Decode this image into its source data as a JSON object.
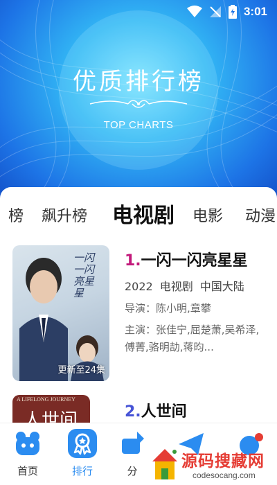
{
  "status_bar": {
    "time": "3:01"
  },
  "hero": {
    "title": "优质排行榜",
    "subtitle": "TOP CHARTS"
  },
  "tabs": [
    {
      "label": "榜",
      "active": false
    },
    {
      "label": "飙升榜",
      "active": false
    },
    {
      "label": "电视剧",
      "active": true
    },
    {
      "label": "电影",
      "active": false
    },
    {
      "label": "动漫",
      "active": false
    }
  ],
  "items": [
    {
      "rank": "1.",
      "title": "一闪一闪亮星星",
      "year": "2022",
      "category": "电视剧",
      "region": "中国大陆",
      "director": "导演：陈小明,章攀",
      "cast": "主演：张佳宁,屈楚萧,吴希泽,傅菁,骆明劼,蒋昀...",
      "update": "更新至24集",
      "poster_text": "一闪一闪亮星星"
    },
    {
      "rank": "2.",
      "title": "人世间",
      "poster_tagline": "A LIFELONG JOURNEY",
      "poster_text": "人世间"
    }
  ],
  "bottom_nav": [
    {
      "label": "首页",
      "icon": "home-icon",
      "active": false
    },
    {
      "label": "排行",
      "icon": "ranking-icon",
      "active": true
    },
    {
      "label": "分",
      "icon": "category-icon",
      "active": false
    }
  ],
  "watermark": {
    "main": "源码搜藏网",
    "sub": "codesocang.com"
  },
  "colors": {
    "accent": "#2b8cf0",
    "rank1": "#c2187a",
    "rank2": "#4653d6",
    "hero": "#1d74e6"
  }
}
